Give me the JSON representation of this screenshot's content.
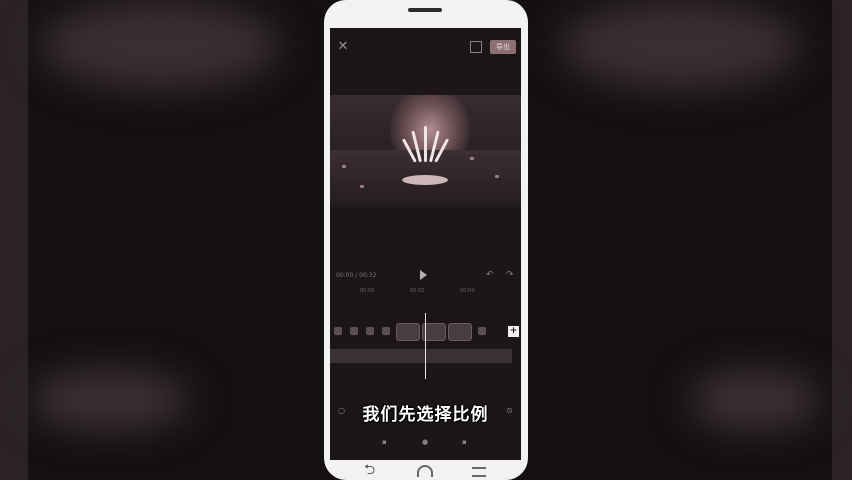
{
  "editor": {
    "export_label": "导出",
    "subtitle": "我们先选择比例",
    "timecode": "00:00 / 00:32",
    "ruler_ticks": [
      "00:00",
      "00:02",
      "00:04"
    ]
  },
  "icons": {
    "close": "close-icon",
    "fullscreen": "fullscreen-icon",
    "play": "play-icon",
    "undo": "undo-icon",
    "redo": "redo-icon",
    "add_clip": "plus-icon",
    "nav_back": "back-icon",
    "nav_home": "home-icon",
    "nav_menu": "menu-icon"
  },
  "colors": {
    "screen_bg": "#1c1617",
    "export_button": "#8c6f74",
    "subtitle_text": "#ffffff",
    "phone_frame": "#f2f2f2"
  }
}
